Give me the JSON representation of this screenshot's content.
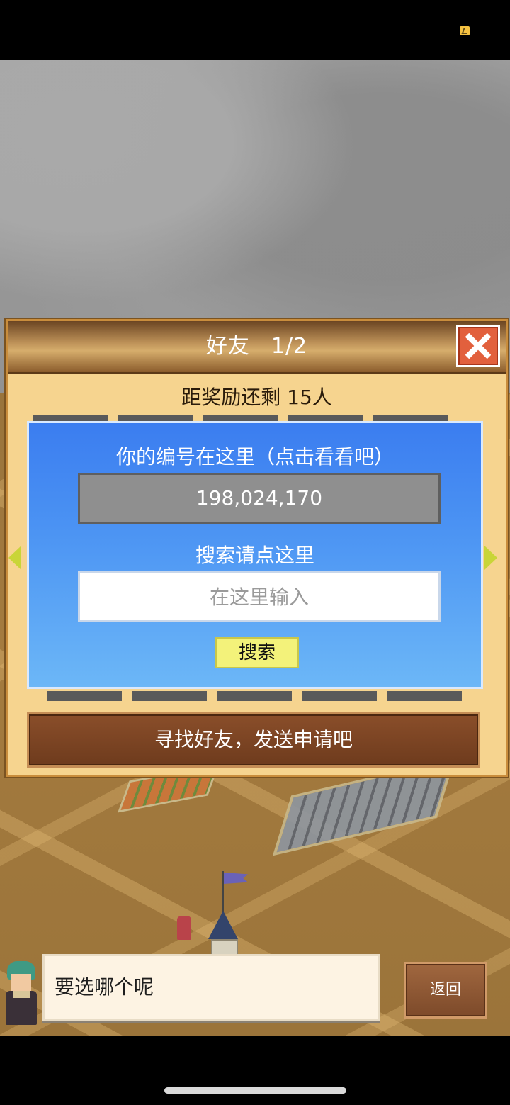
{
  "dialog": {
    "title": "好友",
    "page_indicator": "1/2",
    "reward_text": "距奖励还剩 15人"
  },
  "search_panel": {
    "id_label": "你的编号在这里（点击看看吧）",
    "player_id": "198,024,170",
    "search_label": "搜索请点这里",
    "search_placeholder": "在这里输入",
    "search_value": "",
    "search_button": "搜索"
  },
  "find_friends_button": "寻找好友，发送申请吧",
  "message_bar": {
    "speech": "要选哪个呢",
    "back_button": "返回"
  },
  "colors": {
    "dialog_bg": "#f6d48f",
    "panel_blue": "#4b93f3",
    "search_button_yellow": "#f3f27a",
    "close_red": "#e2603d",
    "arrow_yellow_green": "#c9d538"
  },
  "icons": [
    "battery-icon",
    "close-icon",
    "arrow-left-icon",
    "arrow-right-icon"
  ]
}
